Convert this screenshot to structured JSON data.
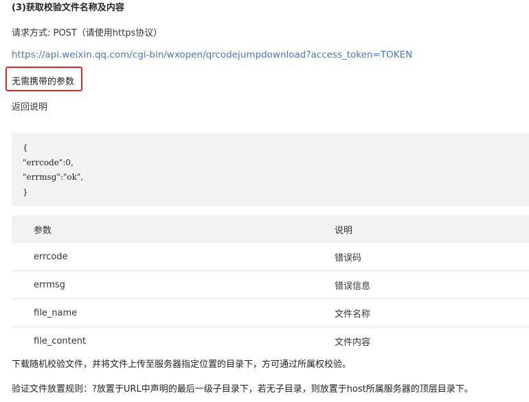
{
  "heading": "(3)获取校验文件名称及内容",
  "request_method": "请求方式: POST（请使用https协议）",
  "url": "https://api.weixin.qq.com/cgi-bin/wxopen/qrcodejumpdownload?access_token=TOKEN",
  "no_params_note": "无需携带的参数",
  "return_label": "返回说明",
  "code_lines": [
    "{",
    "\"errcode\":0,",
    "\"errmsg\":\"ok\",",
    "}"
  ],
  "table": {
    "headers": [
      "参数",
      "说明"
    ],
    "rows": [
      [
        "errcode",
        "错误码"
      ],
      [
        "errmsg",
        "错误信息"
      ],
      [
        "file_name",
        "文件名称"
      ],
      [
        "file_content",
        "文件内容"
      ]
    ]
  },
  "paragraph_download": "下载随机校验文件，并将文件上传至服务器指定位置的目录下，方可通过所属权校验。",
  "paragraph_rule": "验证文件放置规则：?放置于URL中声明的最后一级子目录下，若无子目录，则放置于host所属服务器的顶层目录下。",
  "colors": {
    "link": "#4577cc",
    "highlight_border": "#e0282a",
    "code_bg": "#f2f2f2"
  }
}
